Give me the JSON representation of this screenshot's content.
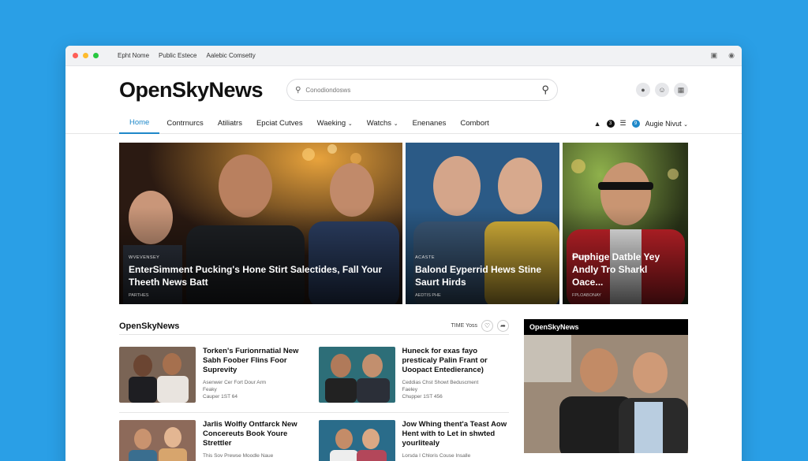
{
  "browser": {
    "tabs": [
      "Epht Nome",
      "Public Estece",
      "Aalebic Comsetty"
    ],
    "dots": [
      "#ff5f57",
      "#febc2e",
      "#28c840"
    ]
  },
  "site": {
    "logo": "OpenSkyNews",
    "search_placeholder": "Conodiondosws",
    "header_icons": [
      "mic-icon",
      "user-icon",
      "grid-icon"
    ]
  },
  "nav": {
    "items": [
      "Home",
      "Contrnurcs",
      "Atiliatrs",
      "Epciat Cutves",
      "Waeking",
      "Watchs",
      "Enenanes",
      "Combort"
    ],
    "dropdowns": [
      false,
      false,
      false,
      false,
      true,
      true,
      false,
      false
    ],
    "badge_dark": "3",
    "badge_blue": "9",
    "account": "Augie Nivut"
  },
  "hero": [
    {
      "kicker": "WVEVENSEY",
      "headline": "EnterSimment Pucking's Hone Stirt Salectides, Fall Your Theeth News Batt",
      "meta": "PARTHES"
    },
    {
      "kicker": "ACASTE",
      "headline": "Balond Eyperrid Hews Stine Saurt Hirds",
      "meta": "AEDTIS PHE"
    },
    {
      "kicker": "WAONK",
      "headline": "Puphige Datble Yey Andly Tro Sharkl Oace...",
      "meta": "FPLOABONAY"
    }
  ],
  "section": {
    "title": "OpenSkyNews",
    "filter_label": "TIME Yoss"
  },
  "stories": [
    {
      "headline": "Torken's Furionrnatial New Sabh Foober Flins Foor Suprevity",
      "source": "Asenwer Cer Fort Dour Arm",
      "author": "Feaky",
      "time": "Cauper 1ST 64"
    },
    {
      "headline": "Huneck for exas fayo presticaly Palin Frant or Uoopact Entedierance)",
      "source": "Ceddias Chst Showt Beduscment",
      "author": "Faeley",
      "time": "Chupper 1ST 456"
    },
    {
      "headline": "Jarlis Wolfly Ontfarck New Concereuts Book Youre Strettler",
      "source": "This Sov Prewse Moodle Naue",
      "author": "",
      "time": ""
    },
    {
      "headline": "Jow Whing thent'a Teast Aow Hent with to Let in shwted yourlitealy",
      "source": "Lorsda I Chloris Couse Insalle",
      "author": "",
      "time": ""
    }
  ],
  "sidebar": {
    "title": "OpenSkyNews"
  },
  "colors": {
    "background": "#2a9fe6",
    "accent": "#1e88c9",
    "hero2_red": "#c9232a"
  }
}
